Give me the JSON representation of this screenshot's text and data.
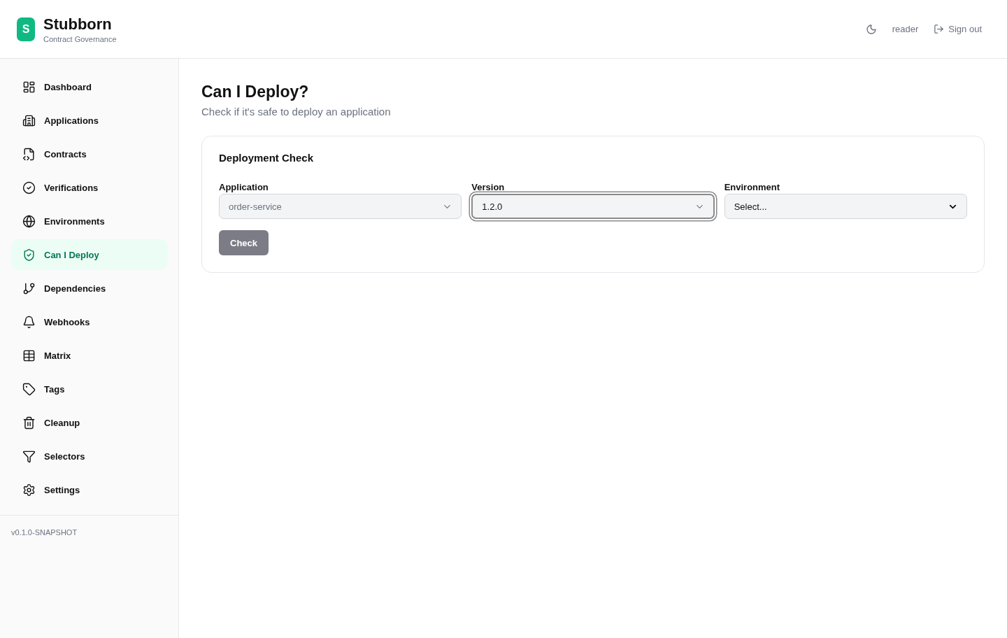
{
  "brand": {
    "logo": "S",
    "name": "Stubborn",
    "tagline": "Contract Governance"
  },
  "header": {
    "user": "reader",
    "sign_out": "Sign out"
  },
  "sidebar": {
    "items": [
      {
        "label": "Dashboard",
        "selected": false
      },
      {
        "label": "Applications",
        "selected": false
      },
      {
        "label": "Contracts",
        "selected": false
      },
      {
        "label": "Verifications",
        "selected": false
      },
      {
        "label": "Environments",
        "selected": false
      },
      {
        "label": "Can I Deploy",
        "selected": true
      },
      {
        "label": "Dependencies",
        "selected": false
      },
      {
        "label": "Webhooks",
        "selected": false
      },
      {
        "label": "Matrix",
        "selected": false
      },
      {
        "label": "Tags",
        "selected": false
      },
      {
        "label": "Cleanup",
        "selected": false
      },
      {
        "label": "Selectors",
        "selected": false
      },
      {
        "label": "Settings",
        "selected": false
      }
    ],
    "version": "v0.1.0-SNAPSHOT"
  },
  "page": {
    "title": "Can I Deploy?",
    "subtitle": "Check if it's safe to deploy an application"
  },
  "card": {
    "title": "Deployment Check",
    "fields": [
      {
        "label": "Application",
        "value": "order-service",
        "disabled": true,
        "focused": false
      },
      {
        "label": "Version",
        "value": "1.2.0",
        "disabled": false,
        "focused": true
      },
      {
        "label": "Environment",
        "value": "Select...",
        "disabled": false,
        "focused": false
      }
    ],
    "button": {
      "label": "Check",
      "disabled": true
    }
  }
}
